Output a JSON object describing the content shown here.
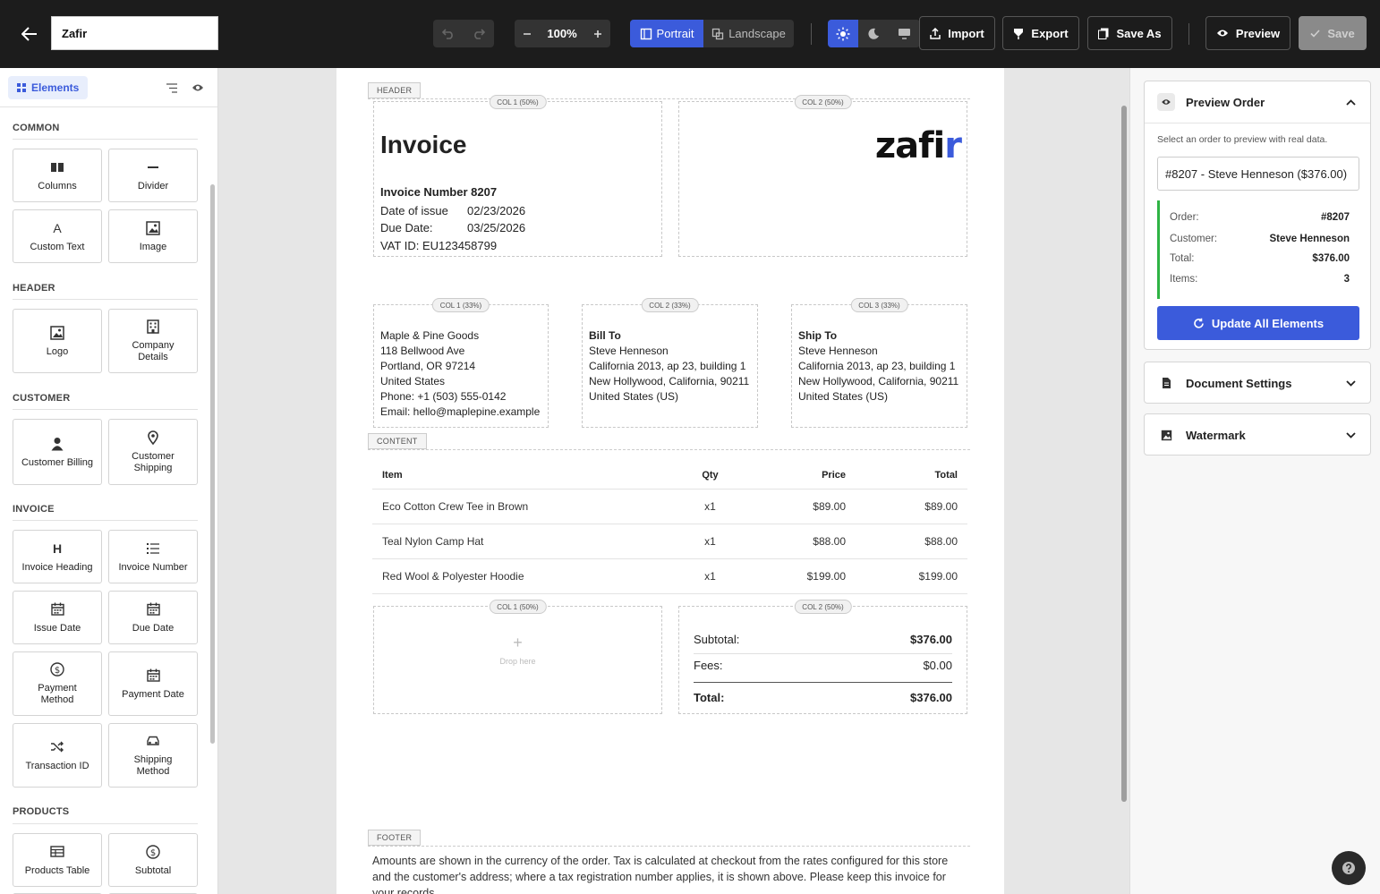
{
  "topbar": {
    "document_name": "Zafir",
    "zoom": "100%",
    "portrait_label": "Portrait",
    "landscape_label": "Landscape",
    "import_label": "Import",
    "export_label": "Export",
    "save_as_label": "Save As",
    "preview_label": "Preview",
    "save_label": "Save"
  },
  "sidebar": {
    "tab_label": "Elements",
    "sections": {
      "common": "COMMON",
      "header": "HEADER",
      "customer": "CUSTOMER",
      "invoice": "INVOICE",
      "products": "PRODUCTS"
    },
    "items": {
      "columns": "Columns",
      "divider": "Divider",
      "custom_text": "Custom Text",
      "image": "Image",
      "logo": "Logo",
      "company_details": "Company Details",
      "customer_billing": "Customer Billing",
      "customer_shipping": "Customer Shipping",
      "invoice_heading": "Invoice Heading",
      "invoice_number": "Invoice Number",
      "issue_date": "Issue Date",
      "due_date": "Due Date",
      "payment_method": "Payment Method",
      "payment_date": "Payment Date",
      "transaction_id": "Transaction ID",
      "shipping_method": "Shipping Method",
      "products_table": "Products Table",
      "subtotal": "Subtotal"
    }
  },
  "document": {
    "tags": {
      "header": "HEADER",
      "content": "CONTENT",
      "footer": "FOOTER"
    },
    "col_tags": {
      "half1": "COL 1 (50%)",
      "half2": "COL 2 (50%)",
      "third1": "COL 1 (33%)",
      "third2": "COL 2 (33%)",
      "third3": "COL 3 (33%)"
    },
    "invoice_title": "Invoice",
    "invoice_number": "Invoice Number 8207",
    "date_of_issue_label": "Date of issue",
    "date_of_issue": "02/23/2026",
    "due_date_label": "Due Date:",
    "due_date": "03/25/2026",
    "vat": "VAT ID: EU123458799",
    "logo_main": "zafi",
    "logo_accent": "r",
    "company": {
      "name": "Maple & Pine Goods",
      "street": "118 Bellwood Ave",
      "city": "Portland, OR 97214",
      "country": "United States",
      "phone": "Phone: +1 (503) 555-0142",
      "email": "Email: hello@maplepine.example"
    },
    "bill_to": {
      "heading": "Bill To",
      "name": "Steve Henneson",
      "line1": "California 2013, ap 23, building 1",
      "line2": "New Hollywood, California, 90211",
      "line3": "United States (US)"
    },
    "ship_to": {
      "heading": "Ship To",
      "name": "Steve Henneson",
      "line1": "California 2013, ap 23, building 1",
      "line2": "New Hollywood, California, 90211",
      "line3": "United States (US)"
    },
    "table": {
      "headers": [
        "Item",
        "Qty",
        "Price",
        "Total"
      ],
      "rows": [
        [
          "Eco Cotton Crew Tee in Brown",
          "x1",
          "$89.00",
          "$89.00"
        ],
        [
          "Teal Nylon Camp Hat",
          "x1",
          "$88.00",
          "$88.00"
        ],
        [
          "Red Wool & Polyester Hoodie",
          "x1",
          "$199.00",
          "$199.00"
        ]
      ]
    },
    "drop_plus": "+",
    "drop_text": "Drop here",
    "subtotal_label": "Subtotal:",
    "subtotal": "$376.00",
    "fees_label": "Fees:",
    "fees": "$0.00",
    "total_label": "Total:",
    "total": "$376.00",
    "footer_text": "Amounts are shown in the currency of the order. Tax is calculated at checkout from the rates configured for this store and the customer's address; where a tax registration number applies, it is shown above. Please keep this invoice for your records."
  },
  "rpanel": {
    "preview_order_title": "Preview Order",
    "preview_desc": "Select an order to preview with real data.",
    "selected_order": "#8207 - Steve Henneson ($376.00)",
    "info": {
      "order_label": "Order:",
      "order": "#8207",
      "customer_label": "Customer:",
      "customer": "Steve Henneson",
      "total_label": "Total:",
      "total": "$376.00",
      "items_label": "Items:",
      "items": "3"
    },
    "update_btn": "Update All Elements",
    "document_settings": "Document Settings",
    "watermark": "Watermark"
  },
  "colors": {
    "accent": "#3b5bdb",
    "success": "#2fb344",
    "topbar": "#1c1c1c"
  }
}
